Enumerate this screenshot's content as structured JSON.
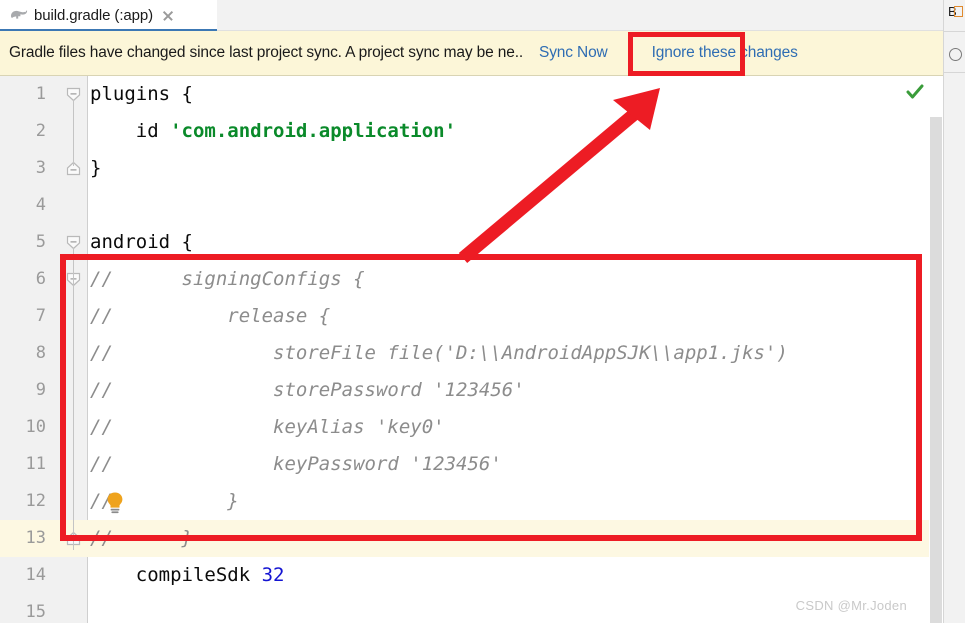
{
  "window": {
    "tab": {
      "label": "build.gradle (:app)",
      "icon": "gradle-elephant-icon",
      "close_icon": "close-icon"
    }
  },
  "notification": {
    "message": "Gradle files have changed since last project sync. A project sync may be ne..",
    "links": [
      {
        "label": "Sync Now",
        "name": "sync-now-link"
      },
      {
        "label": "Ignore these changes",
        "name": "ignore-changes-link"
      }
    ],
    "background": "#fcf6d8",
    "link_color": "#2f6db3"
  },
  "editor": {
    "status_icon": "green-check-icon",
    "caret_line": 13,
    "lines": [
      {
        "num": "1",
        "text": "plugins {",
        "type": "code",
        "fold": "open"
      },
      {
        "num": "2",
        "text": "    id 'com.android.application'",
        "type": "code",
        "fold": ""
      },
      {
        "num": "3",
        "text": "}",
        "type": "code",
        "fold": "close"
      },
      {
        "num": "4",
        "text": "",
        "type": "code",
        "fold": ""
      },
      {
        "num": "5",
        "text": "android {",
        "type": "code",
        "fold": "open"
      },
      {
        "num": "6",
        "text": "//      signingConfigs {",
        "type": "comment",
        "fold": "open"
      },
      {
        "num": "7",
        "text": "//          release {",
        "type": "comment",
        "fold": ""
      },
      {
        "num": "8",
        "text": "//              storeFile file('D:\\\\AndroidAppSJK\\\\app1.jks')",
        "type": "comment",
        "fold": ""
      },
      {
        "num": "9",
        "text": "//              storePassword '123456'",
        "type": "comment",
        "fold": ""
      },
      {
        "num": "10",
        "text": "//              keyAlias 'key0'",
        "type": "comment",
        "fold": ""
      },
      {
        "num": "11",
        "text": "//              keyPassword '123456'",
        "type": "comment",
        "fold": ""
      },
      {
        "num": "12",
        "text": "//          }",
        "type": "comment",
        "fold": "",
        "hint": "lightbulb-icon"
      },
      {
        "num": "13",
        "text": "//      }",
        "type": "comment",
        "fold": "close"
      },
      {
        "num": "14",
        "text": "    compileSdk 32",
        "type": "code",
        "fold": ""
      },
      {
        "num": "15",
        "text": "",
        "type": "code",
        "fold": ""
      }
    ],
    "colors": {
      "string": "#0a8a2a",
      "number": "#1414d2",
      "comment": "#8c8c8c",
      "caret_line_bg": "#fdf8e2"
    }
  },
  "annotations": {
    "color": "#ed1c24",
    "code_box": "highlight-rectangle-signing-config",
    "sync_box": "highlight-rectangle-sync-now",
    "arrow": "red-arrow-pointing-to-sync-now"
  },
  "watermark": {
    "text": "CSDN @Mr.Joden"
  },
  "right_strip": {
    "letter": "B"
  }
}
